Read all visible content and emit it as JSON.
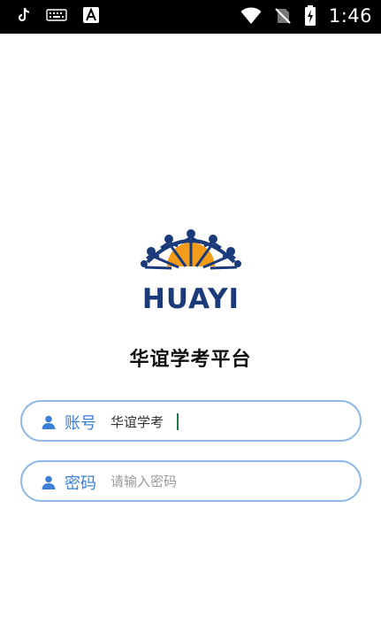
{
  "status_bar": {
    "time": "1:46",
    "icons": [
      "tiktok-icon",
      "keyboard-icon",
      "font-a-icon",
      "wifi-icon",
      "no-sim-icon",
      "battery-charging-icon"
    ]
  },
  "logo": {
    "text": "HUAYI"
  },
  "app_title": "华谊学考平台",
  "form": {
    "account": {
      "label": "账号",
      "value": "华谊学考",
      "icon": "user-icon"
    },
    "password": {
      "label": "密码",
      "placeholder": "请输入密码",
      "icon": "user-icon"
    }
  },
  "colors": {
    "field_border": "#8fb8e8",
    "label_blue": "#3b7fd9",
    "logo_navy": "#1a3a7a",
    "logo_orange": "#f39c1a"
  }
}
